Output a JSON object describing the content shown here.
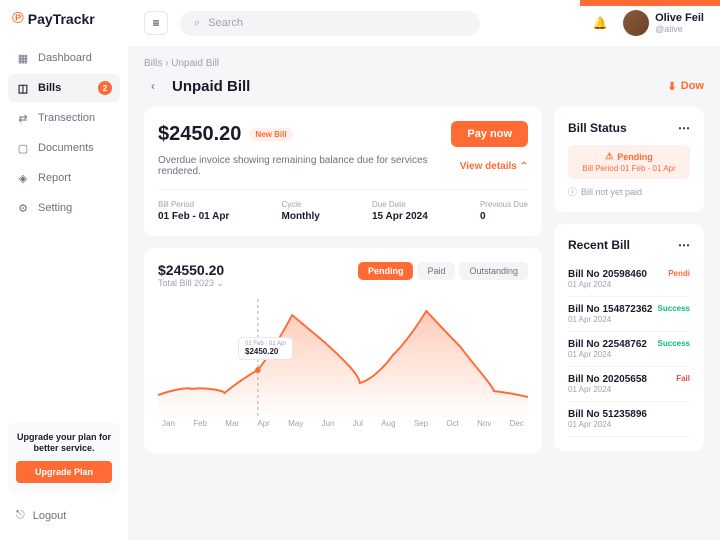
{
  "brand": "PayTrackr",
  "search": {
    "placeholder": "Search"
  },
  "user": {
    "name": "Olive Feil",
    "handle": "@alive"
  },
  "nav": {
    "items": [
      {
        "label": "Dashboard"
      },
      {
        "label": "Bills",
        "badge": "2"
      },
      {
        "label": "Transection"
      },
      {
        "label": "Documents"
      },
      {
        "label": "Report"
      },
      {
        "label": "Setting"
      }
    ]
  },
  "upgrade": {
    "text": "Upgrade your plan for better service.",
    "button": "Upgrade Plan"
  },
  "logout": "Logout",
  "breadcrumb": "Bills  ›  Unpaid Bill",
  "page_title": "Unpaid Bill",
  "download": "Dow",
  "summary": {
    "amount": "$2450.20",
    "badge": "New Bill",
    "pay_btn": "Pay now",
    "desc": "Overdue invoice showing remaining balance due for services rendered.",
    "view_details": "View details ⌃",
    "meta": [
      {
        "label": "Bill Period",
        "value": "01 Feb - 01 Apr"
      },
      {
        "label": "Cycle",
        "value": "Monthly"
      },
      {
        "label": "Due Date",
        "value": "15 Apr 2024"
      },
      {
        "label": "Previous Due",
        "value": "0"
      }
    ]
  },
  "chart_data": {
    "type": "area",
    "title_amount": "$24550.20",
    "subtitle": "Total Bill 2023 ⌄",
    "tabs": [
      "Pending",
      "Paid",
      "Outstanding"
    ],
    "active_tab": 0,
    "categories": [
      "Jan",
      "Feb",
      "Mar",
      "Apr",
      "May",
      "Jun",
      "Jul",
      "Aug",
      "Sep",
      "Oct",
      "Nov",
      "Dec"
    ],
    "values": [
      1200,
      1500,
      1300,
      2450,
      5200,
      3800,
      2400,
      1800,
      3200,
      5400,
      3600,
      1400
    ],
    "tooltip": {
      "date": "01 Feb - 01 Apr",
      "value": "$2450.20",
      "index": 3
    },
    "ylim": [
      0,
      6000
    ]
  },
  "status": {
    "title": "Bill Status",
    "pending": "Pending",
    "period": "Bill Period 01 Feb - 01 Apr",
    "not_paid": "Bill not yet paid"
  },
  "recent": {
    "title": "Recent Bill",
    "items": [
      {
        "no": "Bill No 20598460",
        "date": "01 Apr 2024",
        "status": "Pendi",
        "cls": "st-pending"
      },
      {
        "no": "Bill No 154872362",
        "date": "01 Apr 2024",
        "status": "Success",
        "cls": "st-success"
      },
      {
        "no": "Bill No 22548762",
        "date": "01 Apr 2024",
        "status": "Success",
        "cls": "st-success"
      },
      {
        "no": "Bill No 20205658",
        "date": "01 Apr 2024",
        "status": "Fail",
        "cls": "st-failed"
      },
      {
        "no": "Bill No 51235896",
        "date": "01 Apr 2024",
        "status": "",
        "cls": ""
      }
    ]
  }
}
